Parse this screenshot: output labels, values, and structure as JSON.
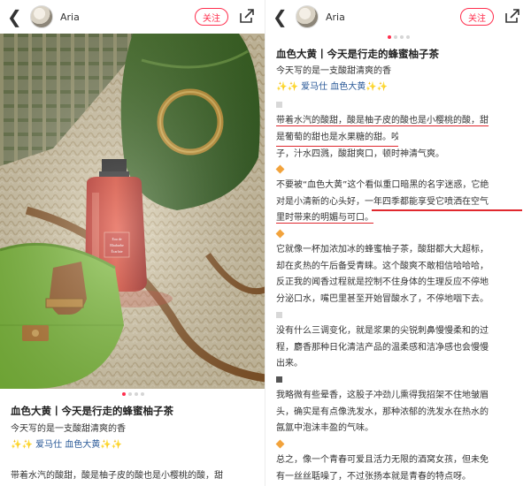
{
  "user": {
    "name": "Aria"
  },
  "header": {
    "follow_label": "关注"
  },
  "post": {
    "title": "血色大黄丨今天是行走的蜂蜜柚子茶",
    "intro": "今天写的是一支酸甜清爽的香",
    "brand_line": {
      "emoji_left": "✨✨",
      "tag": "爱马仕 血色大黄",
      "emoji_right": "✨✨"
    },
    "left_excerpt": "带着水汽的酸甜，酸是柚子皮的酸也是小樱桃的酸，甜",
    "paragraphs": [
      {
        "marker": "square",
        "lines": [
          "带着水汽的酸甜，酸是柚子皮的酸也是小樱桃的酸，甜",
          "是葡萄的甜也是水果糖的甜。咬了一口红彤彤的小果",
          "子，汁水四溅，酸甜爽口，顿时神清气爽。"
        ]
      },
      {
        "marker": "diamond",
        "lines": [
          "不要被“血色大黄”这个看似重口暗黑的名字迷惑，它绝",
          "对是小清新的心头好，一年四季都能享受它喷洒在空气",
          "里时带来的明媚与可口。"
        ]
      },
      {
        "marker": "diamond",
        "lines": [
          "它就像一杯加浓加冰的蜂蜜柚子茶，酸甜都大大超标，",
          "却在炙热的午后备受青睐。这个酸爽不敢相信哈哈哈，",
          "反正我的闻香过程就是控制不住身体的生理反应不停地",
          "分泌口水，嘴巴里甚至开始冒酸水了，不停地咽下去。"
        ]
      },
      {
        "marker": "square",
        "lines": [
          "没有什么三调变化，就是浆果的尖锐刺鼻慢慢柔和的过",
          "程，麝香那种日化清洁产品的温柔感和洁净感也会慢慢",
          "出来。"
        ]
      },
      {
        "marker": "square-dark",
        "lines": [
          "我略微有些晕香，这股子冲劲儿熏得我招架不住地皱眉",
          "头，确实是有点像洗发水，那种浓郁的洗发水在热水的",
          "氤氲中泡沫丰盈的气味。"
        ]
      },
      {
        "marker": "diamond",
        "lines": [
          "总之，像一个青春可爱且活力无限的酒窝女孩，但未免",
          "有一丝丝聒噪了，不过张扬本就是青春的特点呀。"
        ]
      }
    ]
  },
  "image": {
    "bottle_label_line1": "Eau de",
    "bottle_label_line2": "Rhubarbe",
    "bottle_label_line3": "Écarlate"
  },
  "colors": {
    "accent": "#ff2e4d",
    "underline": "#e0282e",
    "tag": "#2b5a98"
  }
}
